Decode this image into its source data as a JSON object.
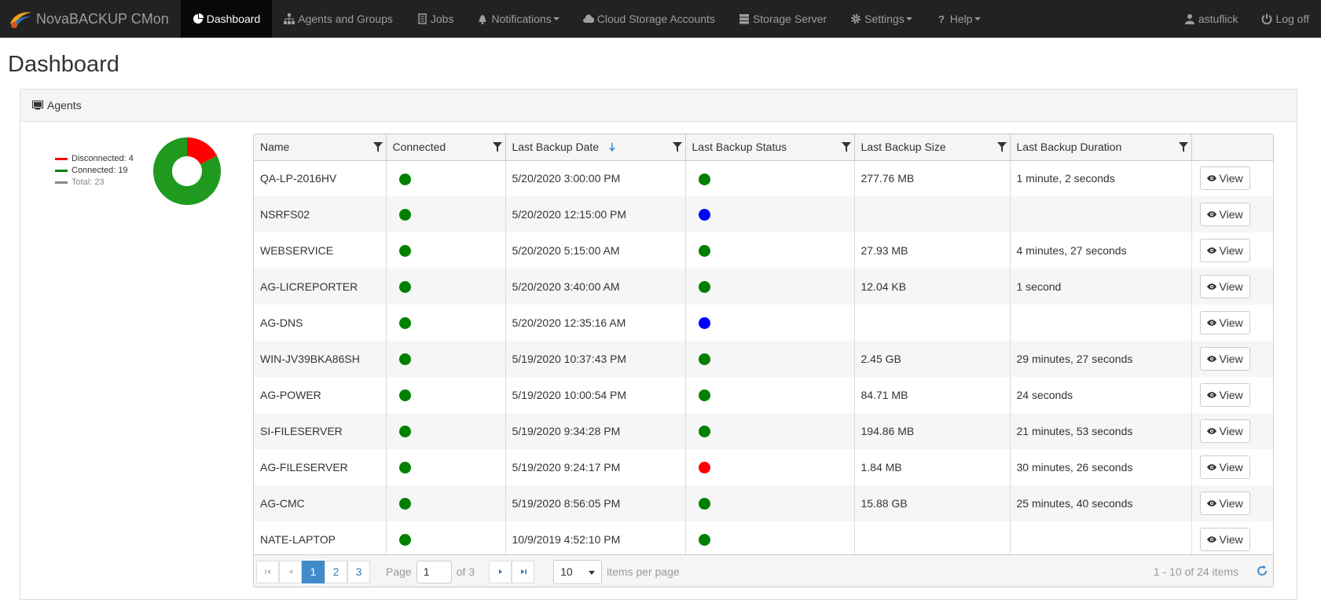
{
  "app": {
    "title": "NovaBACKUP CMon"
  },
  "nav": {
    "items": [
      {
        "label": "Dashboard",
        "icon": "pie-chart-icon",
        "active": true,
        "caret": false
      },
      {
        "label": "Agents and Groups",
        "icon": "sitemap-icon",
        "active": false,
        "caret": false
      },
      {
        "label": "Jobs",
        "icon": "jobs-icon",
        "active": false,
        "caret": false
      },
      {
        "label": "Notifications",
        "icon": "bell-icon",
        "active": false,
        "caret": true
      },
      {
        "label": "Cloud Storage Accounts",
        "icon": "cloud-icon",
        "active": false,
        "caret": false
      },
      {
        "label": "Storage Server",
        "icon": "server-icon",
        "active": false,
        "caret": false
      },
      {
        "label": "Settings",
        "icon": "gear-icon",
        "active": false,
        "caret": true
      },
      {
        "label": "Help",
        "icon": "question-icon",
        "active": false,
        "caret": true
      }
    ],
    "user": "astuflick",
    "logoff": "Log off"
  },
  "page": {
    "title": "Dashboard"
  },
  "panel": {
    "title": "Agents"
  },
  "donut": {
    "legend": [
      {
        "label": "Disconnected: 4",
        "color": "#ff0000"
      },
      {
        "label": "Connected: 19",
        "color": "#008000"
      },
      {
        "label": "Total: 23",
        "color": "#888888"
      }
    ],
    "disconnected": 4,
    "connected": 19,
    "total": 23
  },
  "grid": {
    "columns": [
      "Name",
      "Connected",
      "Last Backup Date",
      "Last Backup Status",
      "Last Backup Size",
      "Last Backup Duration",
      ""
    ],
    "sort_column": "Last Backup Date",
    "view_label": "View",
    "status_colors": {
      "connected": "#008000",
      "success": "#008000",
      "info": "#0000ff",
      "error": "#ff0000"
    },
    "rows": [
      {
        "name": "QA-LP-2016HV",
        "connected": "connected",
        "date": "5/20/2020 3:00:00 PM",
        "status": "success",
        "size": "277.76 MB",
        "duration": "1 minute, 2 seconds"
      },
      {
        "name": "NSRFS02",
        "connected": "connected",
        "date": "5/20/2020 12:15:00 PM",
        "status": "info",
        "size": "",
        "duration": ""
      },
      {
        "name": "WEBSERVICE",
        "connected": "connected",
        "date": "5/20/2020 5:15:00 AM",
        "status": "success",
        "size": "27.93 MB",
        "duration": "4 minutes, 27 seconds"
      },
      {
        "name": "AG-LICREPORTER",
        "connected": "connected",
        "date": "5/20/2020 3:40:00 AM",
        "status": "success",
        "size": "12.04 KB",
        "duration": "1 second"
      },
      {
        "name": "AG-DNS",
        "connected": "connected",
        "date": "5/20/2020 12:35:16 AM",
        "status": "info",
        "size": "",
        "duration": ""
      },
      {
        "name": "WIN-JV39BKA86SH",
        "connected": "connected",
        "date": "5/19/2020 10:37:43 PM",
        "status": "success",
        "size": "2.45 GB",
        "duration": "29 minutes, 27 seconds"
      },
      {
        "name": "AG-POWER",
        "connected": "connected",
        "date": "5/19/2020 10:00:54 PM",
        "status": "success",
        "size": "84.71 MB",
        "duration": "24 seconds"
      },
      {
        "name": "SI-FILESERVER",
        "connected": "connected",
        "date": "5/19/2020 9:34:28 PM",
        "status": "success",
        "size": "194.86 MB",
        "duration": "21 minutes, 53 seconds"
      },
      {
        "name": "AG-FILESERVER",
        "connected": "connected",
        "date": "5/19/2020 9:24:17 PM",
        "status": "error",
        "size": "1.84 MB",
        "duration": "30 minutes, 26 seconds"
      },
      {
        "name": "AG-CMC",
        "connected": "connected",
        "date": "5/19/2020 8:56:05 PM",
        "status": "success",
        "size": "15.88 GB",
        "duration": "25 minutes, 40 seconds"
      },
      {
        "name": "NATE-LAPTOP",
        "connected": "connected",
        "date": "10/9/2019 4:52:10 PM",
        "status": "success",
        "size": "",
        "duration": ""
      }
    ]
  },
  "pager": {
    "pages": [
      "1",
      "2",
      "3"
    ],
    "current_page": "1",
    "page_label": "Page",
    "page_value": "1",
    "of_label": "of 3",
    "page_size": "10",
    "items_per_page_label": "items per page",
    "range_label": "1 - 10 of 24 items"
  }
}
